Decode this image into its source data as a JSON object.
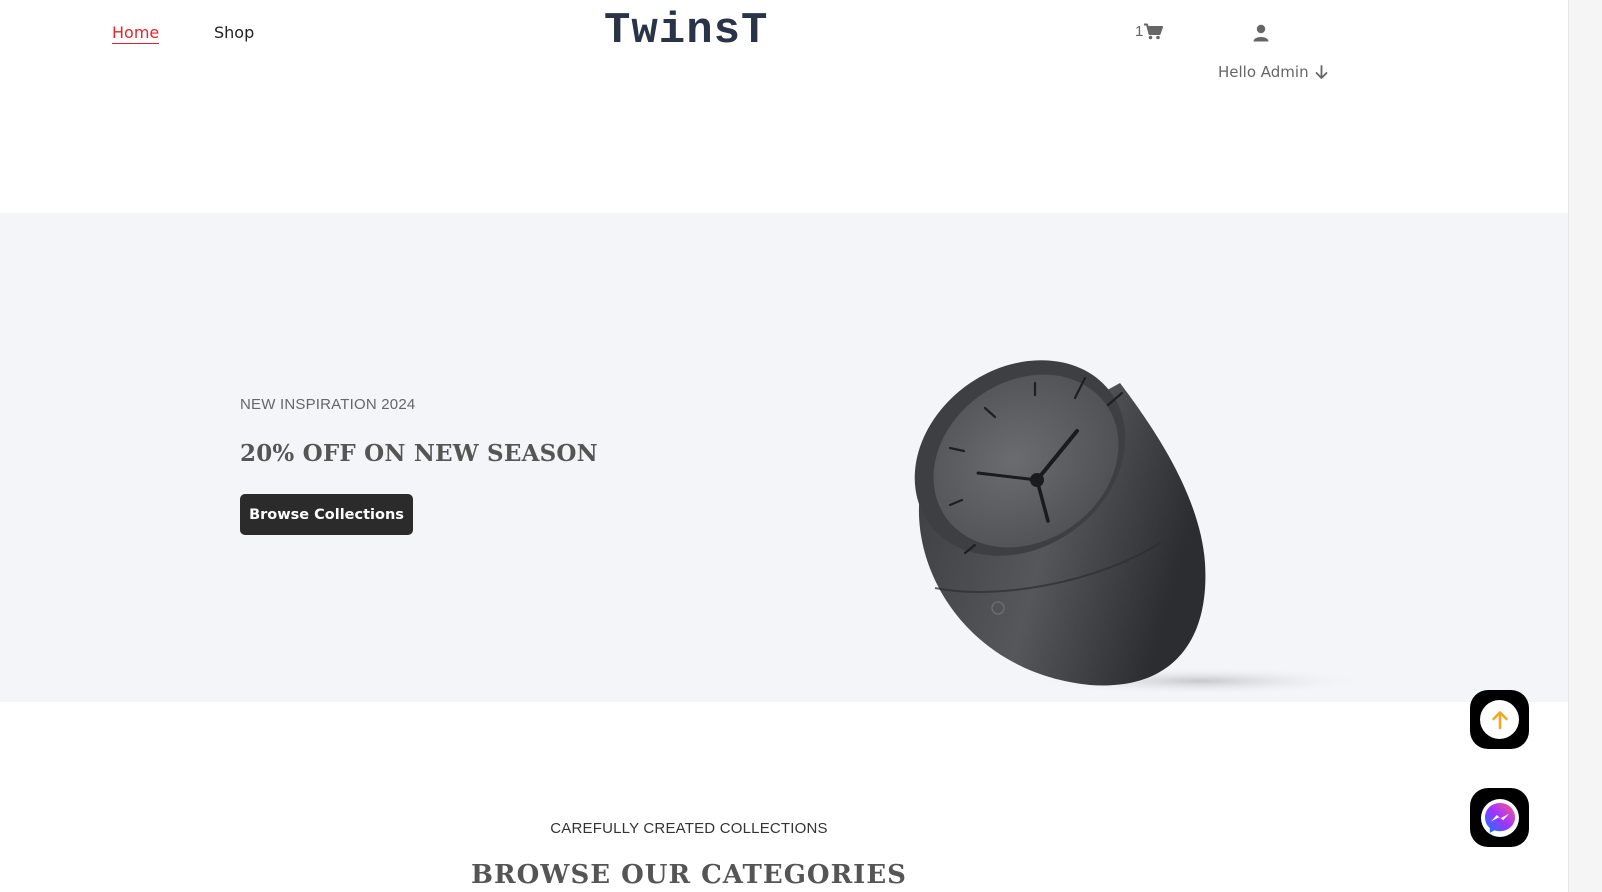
{
  "nav": {
    "home_label": "Home",
    "shop_label": "Shop"
  },
  "brand": {
    "logo_text": "TwinsT"
  },
  "cart": {
    "count": "1"
  },
  "user": {
    "greeting": "Hello Admin"
  },
  "hero": {
    "subtitle": "NEW INSPIRATION 2024",
    "title": "20% OFF ON NEW SEASON",
    "button_label": "Browse Collections"
  },
  "categories": {
    "subtitle": "CAREFULLY CREATED COLLECTIONS",
    "title": "BROWSE OUR CATEGORIES"
  },
  "colors": {
    "accent": "#e4252b",
    "logo": "#2a3446",
    "hero_bg": "#f4f5f8",
    "button_bg": "#2b2b2b",
    "scroll_arrow": "#f5a623"
  },
  "icons": {
    "cart": "cart-icon",
    "user": "user-icon",
    "arrow_down": "arrow-down-icon",
    "scroll_top": "arrow-up-icon",
    "messenger": "messenger-icon"
  }
}
